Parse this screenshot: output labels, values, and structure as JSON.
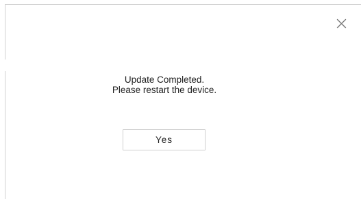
{
  "dialog": {
    "message_line_1": "Update Completed.",
    "message_line_2": "Please restart the device.",
    "yes_label": "Yes",
    "close_icon": "close-icon"
  },
  "colors": {
    "border": "#d0d0d0",
    "text": "#222222",
    "background": "#ffffff",
    "icon": "#777777"
  }
}
